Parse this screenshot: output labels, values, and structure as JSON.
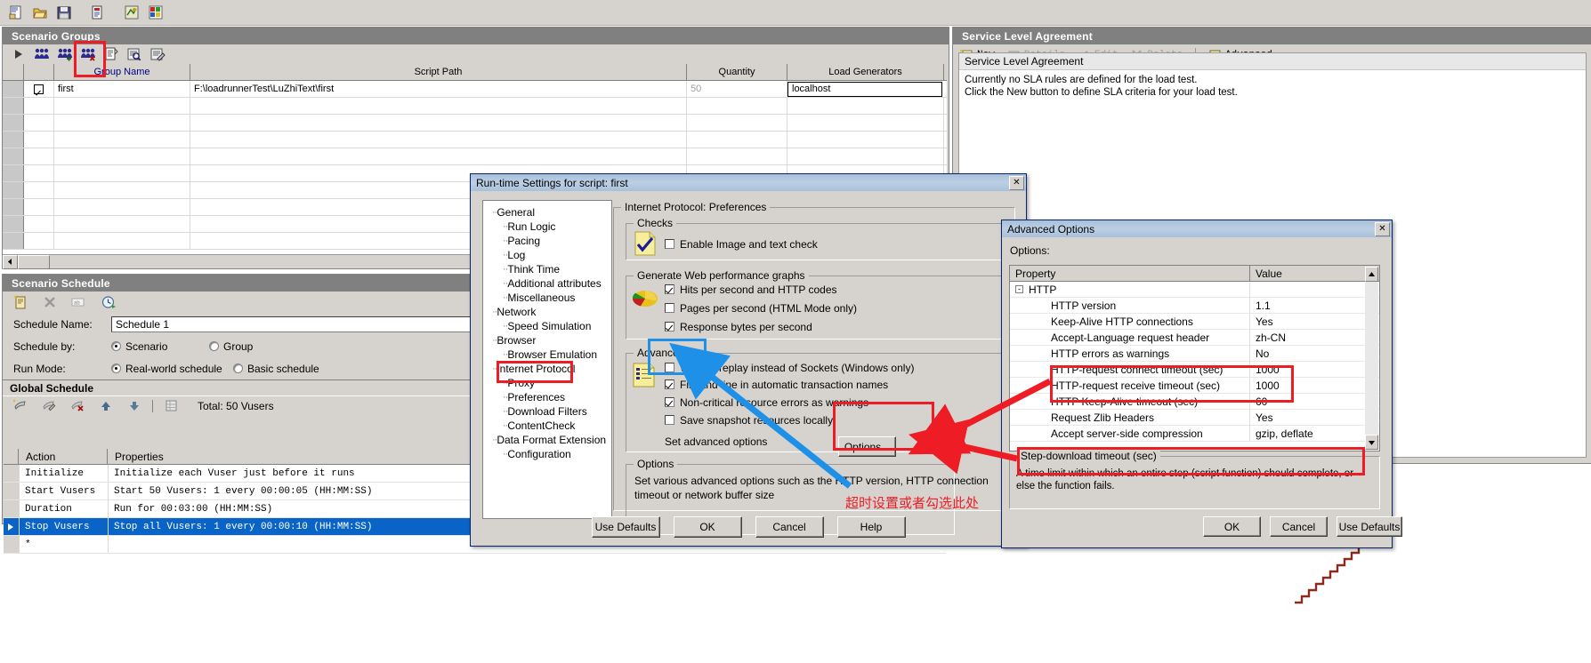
{
  "main_toolbar": {
    "buttons": [
      {
        "name": "new-scenario-icon",
        "tip": "New"
      },
      {
        "name": "open-scenario-icon",
        "tip": "Open"
      },
      {
        "name": "save-scenario-icon",
        "tip": "Save"
      },
      {
        "name": "scenario-details-icon",
        "tip": "Scenario Details"
      },
      {
        "name": "design-view-icon",
        "tip": "Design"
      },
      {
        "name": "run-view-icon",
        "tip": "Run"
      }
    ]
  },
  "scenario_groups": {
    "title": "Scenario Groups",
    "toolbar": [
      {
        "name": "start-scenario-icon",
        "tip": "Start Scenario"
      },
      {
        "name": "add-group-icon",
        "tip": "Add Group"
      },
      {
        "name": "add-vusers-icon",
        "tip": "Add Vusers"
      },
      {
        "name": "remove-vusers-icon",
        "tip": "Remove Vusers"
      },
      {
        "name": "run-time-settings-icon",
        "tip": "Run-time Settings"
      },
      {
        "name": "view-script-icon",
        "tip": "View Script"
      },
      {
        "name": "edit-script-icon",
        "tip": "Edit Script"
      }
    ],
    "columns": [
      "",
      "",
      "Group Name",
      "Script Path",
      "Quantity",
      "Load Generators"
    ],
    "rows": [
      {
        "checked": true,
        "group_name": "first",
        "script_path": "F:\\loadrunnerTest\\LuZhiText\\first",
        "quantity": "50",
        "load_generator": "localhost"
      }
    ],
    "empty_row_count": 9
  },
  "scenario_schedule": {
    "title": "Scenario Schedule",
    "toolbar": [
      {
        "name": "new-schedule-icon"
      },
      {
        "name": "delete-schedule-icon"
      },
      {
        "name": "rename-schedule-icon"
      },
      {
        "name": "schedule-properties-icon"
      }
    ],
    "schedule_name_label": "Schedule Name:",
    "schedule_name_value": "Schedule 1",
    "schedule_by_label": "Schedule by:",
    "schedule_by_options": [
      "Scenario",
      "Group"
    ],
    "schedule_by_selected": "Scenario",
    "run_mode_label": "Run Mode:",
    "run_mode_options": [
      "Real-world schedule",
      "Basic schedule"
    ],
    "run_mode_selected": "Real-world schedule",
    "global_schedule_title": "Global Schedule",
    "global_toolbar": [
      {
        "name": "add-action-icon"
      },
      {
        "name": "edit-action-icon"
      },
      {
        "name": "delete-action-icon"
      },
      {
        "name": "move-up-icon"
      },
      {
        "name": "move-down-icon"
      },
      {
        "name": "schedule-grid-icon"
      }
    ],
    "total_label": "Total: 50 Vusers",
    "grid_columns": [
      "Action",
      "Properties"
    ],
    "grid_rows": [
      {
        "action": "Initialize",
        "properties": "Initialize each Vuser just before it runs",
        "selected": false
      },
      {
        "action": "Start  Vusers",
        "properties": "Start 50 Vusers: 1 every 00:00:05 (HH:MM:SS)",
        "selected": false
      },
      {
        "action": "Duration",
        "properties": "Run for 00:03:00 (HH:MM:SS)",
        "selected": false
      },
      {
        "action": "Stop Vusers",
        "properties": "Stop all Vusers: 1 every 00:00:10 (HH:MM:SS)",
        "selected": true
      },
      {
        "action": "*",
        "properties": "",
        "selected": false
      }
    ]
  },
  "sla": {
    "title": "Service Level Agreement",
    "toolbar": [
      {
        "label": "New",
        "name": "sla-new-button",
        "disabled": false
      },
      {
        "label": "Details",
        "name": "sla-details-button",
        "disabled": true
      },
      {
        "label": "Edit",
        "name": "sla-edit-button",
        "disabled": true
      },
      {
        "label": "Delete",
        "name": "sla-delete-button",
        "disabled": true
      },
      {
        "label": "Advanced",
        "name": "sla-advanced-button",
        "disabled": false
      }
    ],
    "section_header": "Service Level Agreement",
    "body_lines": [
      "Currently no SLA rules are defined for the load test.",
      "Click the New button to define SLA criteria for your load test."
    ]
  },
  "runtime_settings": {
    "title": "Run-time Settings for script: first",
    "close_label": "✕",
    "tree": [
      {
        "label": "General",
        "level": 0
      },
      {
        "label": "Run Logic",
        "level": 1
      },
      {
        "label": "Pacing",
        "level": 1
      },
      {
        "label": "Log",
        "level": 1
      },
      {
        "label": "Think Time",
        "level": 1
      },
      {
        "label": "Additional attributes",
        "level": 1
      },
      {
        "label": "Miscellaneous",
        "level": 1
      },
      {
        "label": "Network",
        "level": 0
      },
      {
        "label": "Speed Simulation",
        "level": 1
      },
      {
        "label": "Browser",
        "level": 0
      },
      {
        "label": "Browser Emulation",
        "level": 1
      },
      {
        "label": "Internet Protocol",
        "level": 0
      },
      {
        "label": "Proxy",
        "level": 1
      },
      {
        "label": "Preferences",
        "level": 1,
        "highlighted": true
      },
      {
        "label": "Download Filters",
        "level": 1
      },
      {
        "label": "ContentCheck",
        "level": 1
      },
      {
        "label": "Data Format Extension",
        "level": 0
      },
      {
        "label": "Configuration",
        "level": 1
      }
    ],
    "pane_title": "Internet Protocol: Preferences",
    "checks_group": "Checks",
    "checks_items": [
      {
        "label": "Enable Image and text check",
        "checked": false
      }
    ],
    "graphs_group": "Generate Web performance graphs",
    "graphs_items": [
      {
        "label": "Hits per second and HTTP codes",
        "checked": true
      },
      {
        "label": "Pages per second (HTML Mode only)",
        "checked": false
      },
      {
        "label": "Response bytes per second",
        "checked": true
      }
    ],
    "advanced_group": "Advanced",
    "advanced_items": [
      {
        "label": "WinInet replay instead of Sockets (Windows only)",
        "checked": false
      },
      {
        "label": "File and line in automatic transaction names",
        "checked": true
      },
      {
        "label": "Non-critical resource errors as warnings",
        "checked": true
      },
      {
        "label": "Save snapshot resources locally",
        "checked": false
      }
    ],
    "set_advanced_label": "Set advanced options",
    "options_button": "Options...",
    "options_group": "Options",
    "options_text_line1": "Set various advanced options such as the HTTP version, HTTP connection",
    "options_text_line2": "timeout or network buffer size",
    "buttons": [
      "Use Defaults",
      "OK",
      "Cancel",
      "Help"
    ]
  },
  "advanced_options": {
    "title": "Advanced Options",
    "close_label": "✕",
    "options_label": "Options:",
    "columns": [
      "Property",
      "Value"
    ],
    "rows": [
      {
        "property": "HTTP",
        "value": "",
        "group": true,
        "expander": "-"
      },
      {
        "property": "HTTP version",
        "value": "1.1"
      },
      {
        "property": "Keep-Alive HTTP connections",
        "value": "Yes"
      },
      {
        "property": "Accept-Language request header",
        "value": "zh-CN"
      },
      {
        "property": "HTTP errors as warnings",
        "value": "No"
      },
      {
        "property": "HTTP-request connect timeout (sec)",
        "value": "1000",
        "highlighted": true
      },
      {
        "property": "HTTP-request receive timeout (sec)",
        "value": "1000",
        "highlighted": true
      },
      {
        "property": "HTTP Keep-Alive timeout (sec)",
        "value": "60"
      },
      {
        "property": "Request Zlib Headers",
        "value": "Yes"
      },
      {
        "property": "Accept server-side compression",
        "value": "gzip, deflate"
      }
    ],
    "detail_group_title": "Step-download timeout (sec)",
    "detail_text": "A time limit within which an entire step (script function) should complete, or else the function fails.",
    "buttons": [
      "OK",
      "Cancel",
      "Use Defaults"
    ]
  },
  "annotations": {
    "chinese_note": "超时设置或者勾选此处",
    "accent_red": "#ee1c25",
    "accent_blue": "#1e90e8"
  }
}
